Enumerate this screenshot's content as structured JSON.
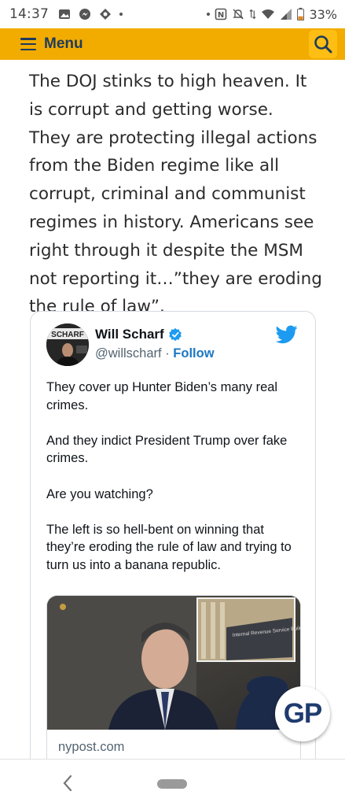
{
  "status_bar": {
    "time": "14:37",
    "battery": "33%",
    "left_icons": [
      "image-icon",
      "messenger-icon",
      "vpn-icon",
      "dot"
    ],
    "right_icons": [
      "dot",
      "nfc-icon",
      "mute-icon",
      "data-arrows-icon",
      "wifi-icon",
      "signal-icon",
      "battery-icon"
    ]
  },
  "menu_bar": {
    "label": "Menu",
    "bg_color": "#f2ac00",
    "text_color": "#1f3b5c"
  },
  "article": {
    "lines": [
      "The DOJ stinks to high heaven.  It",
      "is corrupt and getting worse.",
      "They are protecting illegal actions",
      "from the Biden regime like all",
      "corrupt, criminal and communist",
      "regimes in history.  Americans see",
      "right through it despite the MSM",
      "not reporting it…”they are eroding",
      "the rule of law”."
    ]
  },
  "tweet": {
    "name": "Will Scharf",
    "handle": "@willscharf",
    "separator": "·",
    "follow_label": "Follow",
    "avatar_text": "SCHARF",
    "paragraphs": [
      "They cover up Hunter Biden’s many real crimes.",
      "And they indict President Trump over fake crimes.",
      "Are you watching?",
      "The left is so hell-bent on winning that they’re eroding the rule of law and trying to turn us into a banana republic."
    ],
    "link_card": {
      "domain": "nypost.com",
      "inset_sign_text": "Internal Revenue Service Building"
    }
  },
  "gp_badge": {
    "label": "GP"
  },
  "nav": {
    "back_icon": "chevron-left-icon",
    "home_icon": "home-pill"
  }
}
